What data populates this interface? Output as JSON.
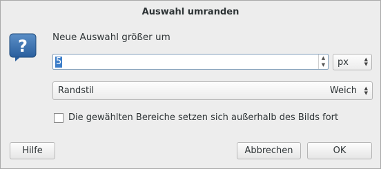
{
  "window": {
    "title": "Auswahl umranden"
  },
  "icon": "question-icon",
  "prompt": "Neue Auswahl größer um",
  "grow": {
    "value": "5",
    "unit": "px"
  },
  "border_style": {
    "label": "Randstil",
    "selected": "Weich"
  },
  "checkbox": {
    "label": "Die gewählten Bereiche setzen sich außerhalb des Bilds fort",
    "checked": false
  },
  "buttons": {
    "help": "Hilfe",
    "cancel": "Abbrechen",
    "ok": "OK"
  },
  "colors": {
    "selection": "#3b7dc9",
    "icon_blue": "#3a6ea5"
  }
}
